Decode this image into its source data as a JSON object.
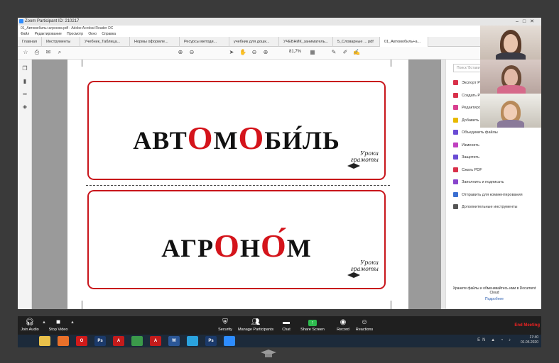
{
  "zoom": {
    "window_title": "Zoom Participant ID: 210217",
    "controls": {
      "join_audio": "Join Audio",
      "stop_video": "Stop Video",
      "security": "Security",
      "manage_participants": "Manage Participants",
      "chat": "Chat",
      "share_screen": "Share Screen",
      "record": "Record",
      "reactions": "Reactions",
      "end_meeting": "End Meeting"
    }
  },
  "acrobat": {
    "title": "01_Автомобиль+агроном.pdf - Adobe Acrobat Reader DC",
    "menu": [
      "Файл",
      "Редактирование",
      "Просмотр",
      "Окно",
      "Справка"
    ],
    "tabs": [
      {
        "label": "Главная"
      },
      {
        "label": "Инструменты"
      },
      {
        "label": "Учебник_Таблица..."
      },
      {
        "label": "Нормы оформле..."
      },
      {
        "label": "Ресурсы методи..."
      },
      {
        "label": "учебник для дошк..."
      },
      {
        "label": "УЧЕБНИК_заниматель..."
      },
      {
        "label": "5_Словарные ... pdf"
      },
      {
        "label": "01_Автомобиль+а..."
      }
    ],
    "zoom_level": "81,7%",
    "search_placeholder": "Поиск 'Вставить'...",
    "tools": [
      {
        "label": "Экспорт PDF",
        "color": "#d9304a"
      },
      {
        "label": "Создать PDF",
        "color": "#d9304a"
      },
      {
        "label": "Редактировать PDF",
        "color": "#d94090"
      },
      {
        "label": "Добавить комментарий",
        "color": "#e8b900"
      },
      {
        "label": "Объединить файлы",
        "color": "#6a4bd4"
      },
      {
        "label": "Изменить",
        "color": "#c040c0"
      },
      {
        "label": "Защитить",
        "color": "#6a4bd4"
      },
      {
        "label": "Сжать PDF",
        "color": "#d9304a"
      },
      {
        "label": "Заполнить и подписать",
        "color": "#8844cc"
      },
      {
        "label": "Отправить для комментирования",
        "color": "#3b6fd1"
      },
      {
        "label": "Дополнительные инструменты",
        "color": "#555555"
      }
    ],
    "cloud_text": "Храните файлы и обменивайтесь ими в Document Cloud",
    "cloud_link": "Подробнее"
  },
  "document": {
    "card1": {
      "pre": "АВТ",
      "hl1": "О",
      "mid": "М",
      "hl2": "О",
      "post": "БИ́ЛЬ"
    },
    "card2": {
      "pre": "АГР",
      "hl1": "О",
      "mid": "Н",
      "hl2": "О́",
      "post": "М"
    },
    "logo_text": "Уроки грамоты"
  },
  "taskbar": {
    "apps": [
      {
        "name": "start",
        "label": "",
        "color": "#1c2a3a"
      },
      {
        "name": "explorer",
        "label": "",
        "color": "#e8c04a"
      },
      {
        "name": "firefox",
        "label": "",
        "color": "#e8702a"
      },
      {
        "name": "opera",
        "label": "O",
        "color": "#d01a1a"
      },
      {
        "name": "photoshop",
        "label": "Ps",
        "color": "#1b3a6b"
      },
      {
        "name": "acrobat",
        "label": "A",
        "color": "#c31b1b"
      },
      {
        "name": "chrome",
        "label": "",
        "color": "#3b9a4a"
      },
      {
        "name": "acrobat2",
        "label": "A",
        "color": "#c31b1b"
      },
      {
        "name": "word",
        "label": "W",
        "color": "#2b5797"
      },
      {
        "name": "telegram",
        "label": "",
        "color": "#2aa3df"
      },
      {
        "name": "photoshop2",
        "label": "Ps",
        "color": "#1b3a6b"
      },
      {
        "name": "zoom",
        "label": "",
        "color": "#2d8cff"
      }
    ],
    "lang": "EN",
    "time": "17:40",
    "date": "01.05.2020"
  }
}
